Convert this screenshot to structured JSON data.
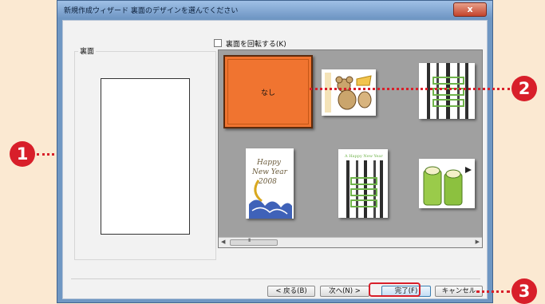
{
  "window": {
    "title": "新規作成ウィザード 裏面のデザインを選んでください",
    "close_label": "x"
  },
  "back_panel": {
    "label": "裏面"
  },
  "rotate_checkbox": {
    "label": "裏面を回転する(K)",
    "checked": false
  },
  "gallery": {
    "none_label": "なし",
    "thumbnails": [
      "なし",
      "mouse-cheese-design",
      "bamboo-wide-design",
      "happy-new-year-design",
      "bamboo-tall-design",
      "bamboo-cut-design"
    ],
    "nyear_text": [
      "Happy",
      "New Year",
      "2008"
    ],
    "bamboo_tall_caption": "A Happy New Year",
    "scroll_grip": "III"
  },
  "buttons": {
    "back": "< 戻る(B)",
    "next": "次へ(N) >",
    "finish": "完了(F)",
    "cancel": "キャンセル"
  },
  "callouts": [
    "1",
    "2",
    "3"
  ],
  "colors": {
    "accent": "#d81f2a",
    "selected": "#f07430",
    "titlebar": "#6f97c3"
  }
}
